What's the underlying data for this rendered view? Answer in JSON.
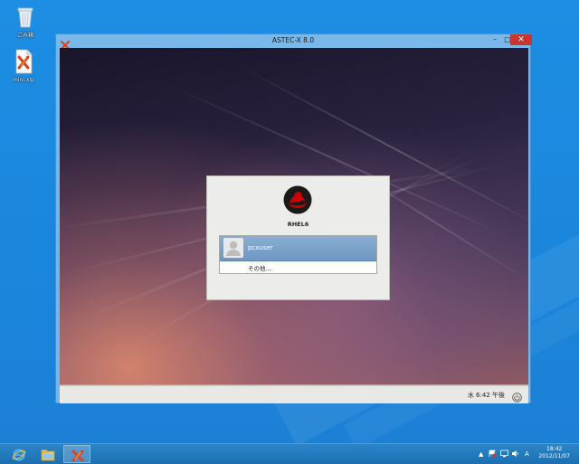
{
  "desktop": {
    "icons": [
      {
        "id": "recycle-bin",
        "label": "ごみ箱",
        "icon": "recycle-bin-icon"
      },
      {
        "id": "mini-xlp",
        "label": "mini.xlp",
        "icon": "astec-x-file-icon"
      }
    ]
  },
  "window": {
    "title": "ASTEC-X 8.0",
    "controls": {
      "minimize": "–",
      "maximize": "□",
      "close": "✕"
    }
  },
  "login": {
    "hostname": "RHEL6",
    "users": [
      {
        "name": "pcxuser"
      }
    ],
    "other_label": "その他..."
  },
  "panel": {
    "clock": "水  6:42 午後"
  },
  "taskbar": {
    "apps": [
      "internet-explorer-icon",
      "file-explorer-icon",
      "astec-x-icon"
    ],
    "tray": {
      "chevron": "▲",
      "ime": "A",
      "time": "18:42",
      "date": "2012/11/07"
    }
  },
  "colors": {
    "desktop": "#1e8ee0",
    "window_frame": "#76b5e8",
    "close_button": "#c7372f",
    "selection": "#7aa3cc"
  }
}
